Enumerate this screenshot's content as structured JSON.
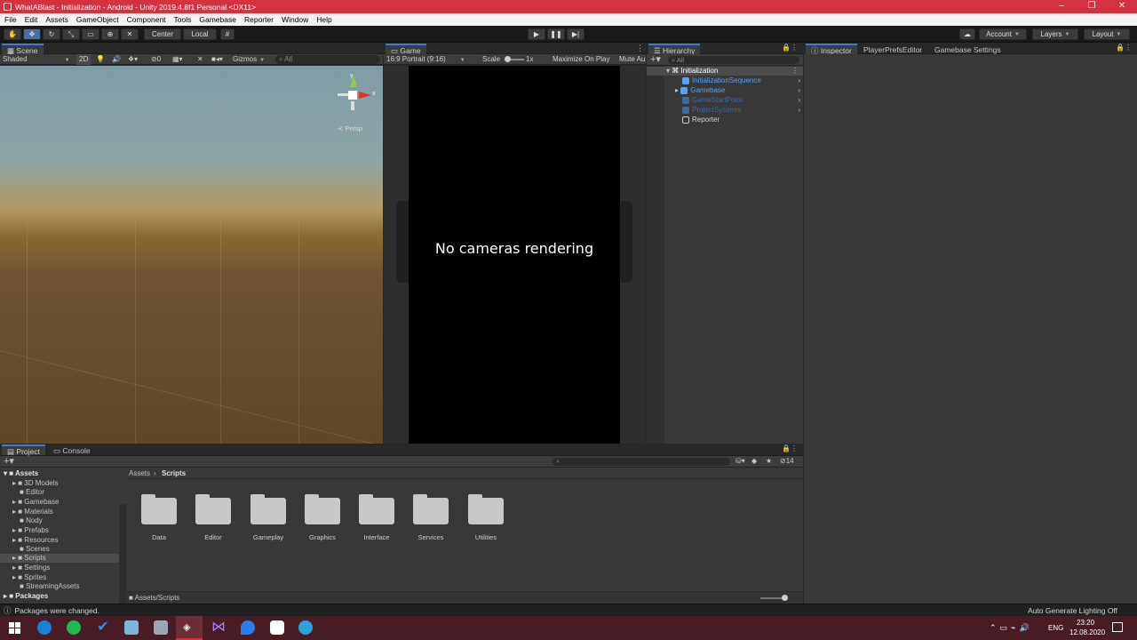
{
  "window": {
    "title": "WhatABlast - Initialization - Android - Unity 2019.4.8f1 Personal <DX11>",
    "controls": [
      "–",
      "❐",
      "✕"
    ]
  },
  "menu": [
    "File",
    "Edit",
    "Assets",
    "GameObject",
    "Component",
    "Tools",
    "Gamebase",
    "Reporter",
    "Window",
    "Help"
  ],
  "toolbar": {
    "pivot": "Center",
    "space": "Local",
    "account": "Account",
    "layers": "Layers",
    "layout": "Layout"
  },
  "scene": {
    "tab": "Scene",
    "shading": "Shaded",
    "mode2d": "2D",
    "gizmos": "Gizmos",
    "search": "All",
    "fx_count": "0",
    "persp": "≺ Persp",
    "axis_y": "y",
    "axis_x": "x"
  },
  "game": {
    "tab": "Game",
    "aspect": "16:9 Portrait (9:16)",
    "scale_label": "Scale",
    "scale_value": "1x",
    "maximize": "Maximize On Play",
    "mute": "Mute Au",
    "message": "No cameras rendering"
  },
  "hierarchy": {
    "tab": "Hierarchy",
    "search": "All",
    "scene": "Initialization",
    "items": [
      {
        "label": "InitializationSequence",
        "color": "#5aa1f0"
      },
      {
        "label": "Gamebase",
        "color": "#5aa1f0"
      },
      {
        "label": "GameStartPoint",
        "color": "#3f6aa0"
      },
      {
        "label": "ProjectSystems",
        "color": "#3f6aa0"
      },
      {
        "label": "Reporter",
        "color": "#d2d2d2"
      }
    ]
  },
  "inspector": {
    "tabs": [
      "Inspector",
      "PlayerPrefsEditor",
      "Gamebase Settings"
    ]
  },
  "project": {
    "tabs": [
      "Project",
      "Console"
    ],
    "root": "Assets",
    "folders": [
      "3D Models",
      "Editor",
      "Gamebase",
      "Materials",
      "Nody",
      "Prefabs",
      "Resources",
      "Scenes",
      "Scripts",
      "Settings",
      "Sprites",
      "StreamingAssets"
    ],
    "packages": "Packages",
    "breadcrumb": [
      "Assets",
      "Scripts"
    ],
    "grid": [
      "Data",
      "Editor",
      "Gameplay",
      "Graphics",
      "Interface",
      "Services",
      "Utilities"
    ],
    "path": "Assets/Scripts",
    "hidden_count": "14"
  },
  "status": {
    "message": "Packages were changed.",
    "right": "Auto Generate Lighting Off"
  },
  "taskbar": {
    "lang": "ENG",
    "time": "23:20",
    "date": "12.08.2020"
  }
}
